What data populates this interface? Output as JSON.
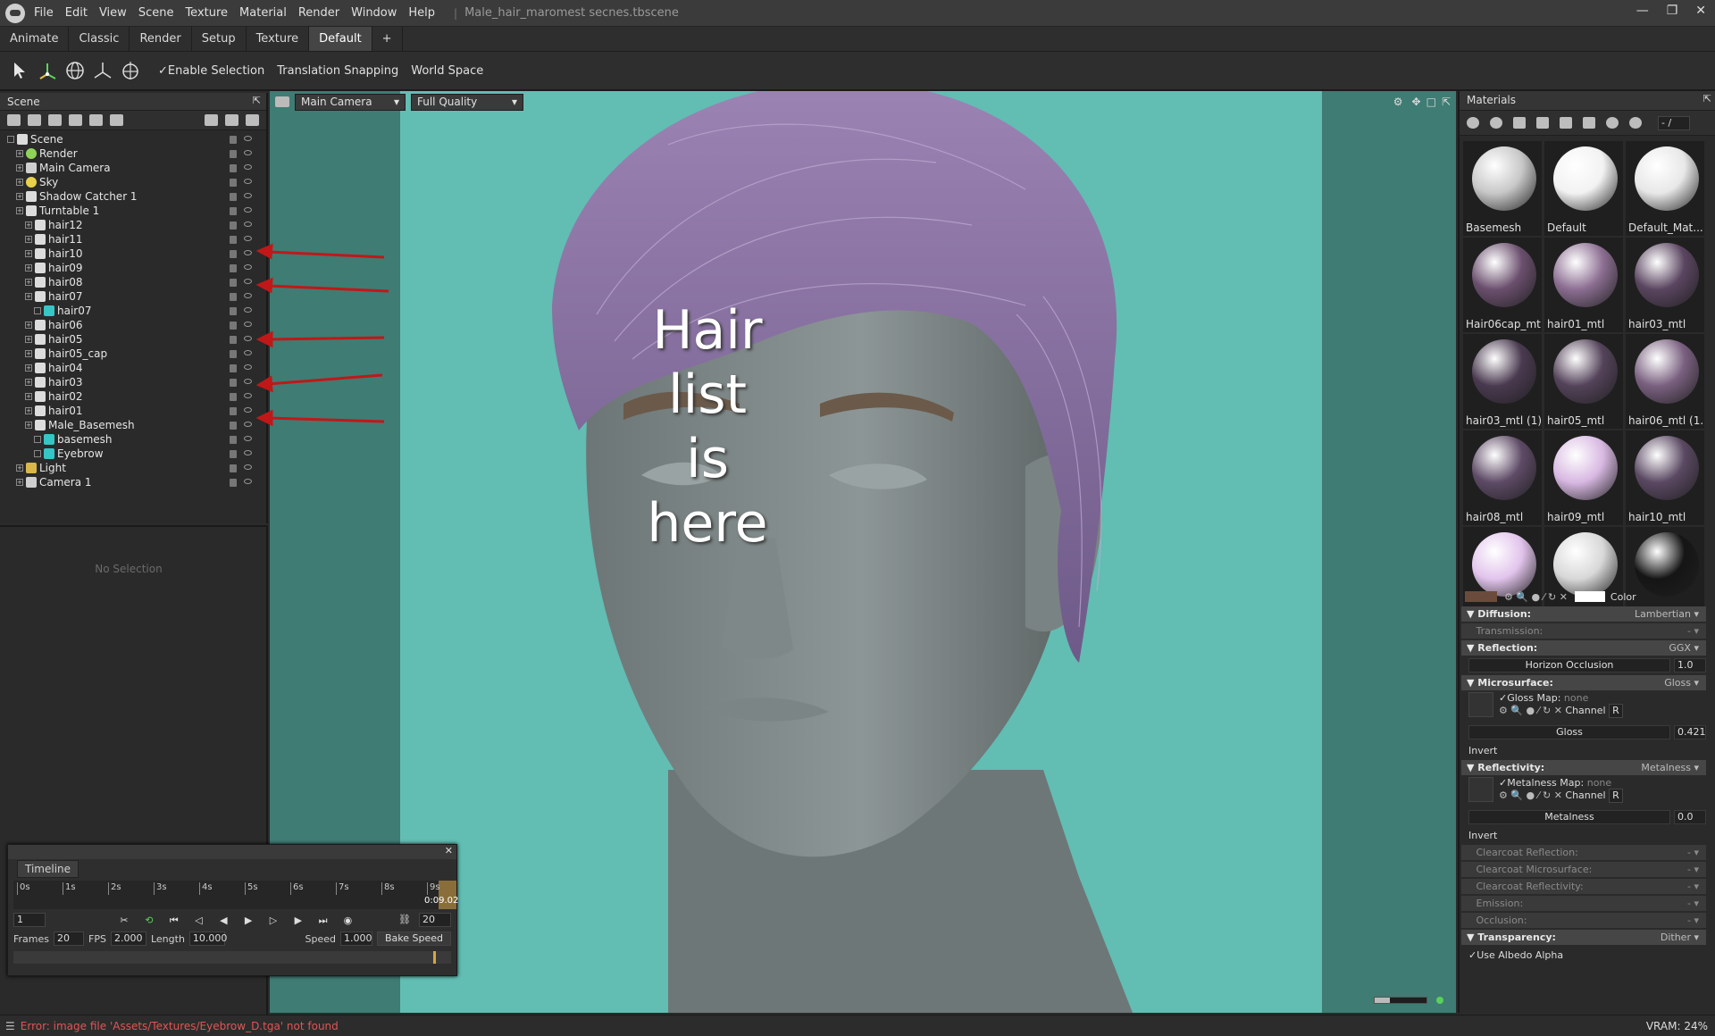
{
  "window": {
    "title": "Male_hair_maromest secnes.tbscene"
  },
  "menu": [
    "File",
    "Edit",
    "View",
    "Scene",
    "Texture",
    "Material",
    "Render",
    "Window",
    "Help"
  ],
  "tabs": [
    "Animate",
    "Classic",
    "Render",
    "Setup",
    "Texture",
    "Default",
    "+"
  ],
  "toolbar": {
    "enable_selection": "Enable Selection",
    "translation_snapping": "Translation Snapping",
    "world_space": "World Space"
  },
  "scene": {
    "title": "Scene",
    "items": [
      {
        "label": "Scene",
        "indent": 0,
        "icon": "scene-icon"
      },
      {
        "label": "Render",
        "indent": 1,
        "icon": "gear-icon"
      },
      {
        "label": "Main Camera",
        "indent": 1,
        "icon": "camera-icon"
      },
      {
        "label": "Sky",
        "indent": 1,
        "icon": "sun-icon"
      },
      {
        "label": "Shadow Catcher 1",
        "indent": 1,
        "icon": "shadow-icon"
      },
      {
        "label": "Turntable 1",
        "indent": 1,
        "icon": "turntable-icon"
      },
      {
        "label": "hair12",
        "indent": 2,
        "icon": "hair-icon"
      },
      {
        "label": "hair11",
        "indent": 2,
        "icon": "hair-icon"
      },
      {
        "label": "hair10",
        "indent": 2,
        "icon": "hair-icon"
      },
      {
        "label": "hair09",
        "indent": 2,
        "icon": "hair-icon"
      },
      {
        "label": "hair08",
        "indent": 2,
        "icon": "hair-icon"
      },
      {
        "label": "hair07",
        "indent": 2,
        "icon": "hair-icon"
      },
      {
        "label": "hair07",
        "indent": 3,
        "icon": "mesh-icon"
      },
      {
        "label": "hair06",
        "indent": 2,
        "icon": "hair-icon"
      },
      {
        "label": "hair05",
        "indent": 2,
        "icon": "hair-icon"
      },
      {
        "label": "hair05_cap",
        "indent": 2,
        "icon": "hair-icon"
      },
      {
        "label": "hair04",
        "indent": 2,
        "icon": "hair-icon"
      },
      {
        "label": "hair03",
        "indent": 2,
        "icon": "hair-icon"
      },
      {
        "label": "hair02",
        "indent": 2,
        "icon": "hair-icon"
      },
      {
        "label": "hair01",
        "indent": 2,
        "icon": "hair-icon"
      },
      {
        "label": "Male_Basemesh",
        "indent": 2,
        "icon": "hair-icon"
      },
      {
        "label": "basemesh",
        "indent": 3,
        "icon": "mesh-icon"
      },
      {
        "label": "Eyebrow",
        "indent": 3,
        "icon": "mesh-icon"
      },
      {
        "label": "Light",
        "indent": 1,
        "icon": "folder-icon"
      },
      {
        "label": "Camera 1",
        "indent": 1,
        "icon": "camera-icon"
      }
    ],
    "no_selection": "No Selection"
  },
  "viewport": {
    "camera": "Main Camera",
    "quality": "Full Quality"
  },
  "annotation": {
    "line1": "Hair",
    "line2": "list",
    "line3": "is",
    "line4": "here"
  },
  "materials": {
    "title": "Materials",
    "counter": "- /",
    "items": [
      {
        "label": "Basemesh",
        "color": "#c8c8c8"
      },
      {
        "label": "Default",
        "color": "#f2f2f2"
      },
      {
        "label": "Default_Mat...",
        "color": "#e8e8e8"
      },
      {
        "label": "Hair06cap_mtl",
        "color": "#6b4f6e"
      },
      {
        "label": "hair01_mtl",
        "color": "#8c6e92"
      },
      {
        "label": "hair03_mtl",
        "color": "#5a4560"
      },
      {
        "label": "hair03_mtl (1)",
        "color": "#4a3a50"
      },
      {
        "label": "hair05_mtl",
        "color": "#54435a"
      },
      {
        "label": "hair06_mtl (1...",
        "color": "#7a6080"
      },
      {
        "label": "hair08_mtl",
        "color": "#5e4a66"
      },
      {
        "label": "hair09_mtl",
        "color": "#d8b8e2"
      },
      {
        "label": "hair10_mtl",
        "color": "#5a4862"
      },
      {
        "label": "",
        "color": "#e2c4ec"
      },
      {
        "label": "",
        "color": "#d8d8d8"
      },
      {
        "label": "",
        "color": "#151515"
      }
    ],
    "color_label": "Color",
    "diffusion": {
      "label": "Diffusion:",
      "value": "Lambertian"
    },
    "transmission": {
      "label": "Transmission:",
      "value": "-"
    },
    "reflection": {
      "label": "Reflection:",
      "value": "GGX"
    },
    "horizon_occlusion": {
      "label": "Horizon Occlusion",
      "value": "1.0"
    },
    "microsurface": {
      "label": "Microsurface:",
      "value": "Gloss"
    },
    "gloss_map": {
      "label": "Gloss Map:",
      "value": "none",
      "channel_label": "Channel",
      "channel": "R"
    },
    "gloss": {
      "label": "Gloss",
      "value": "0.421"
    },
    "invert1": "Invert",
    "reflectivity": {
      "label": "Reflectivity:",
      "value": "Metalness"
    },
    "metalness_map": {
      "label": "Metalness Map:",
      "value": "none",
      "channel_label": "Channel",
      "channel": "R"
    },
    "metalness": {
      "label": "Metalness",
      "value": "0.0"
    },
    "invert2": "Invert",
    "clearcoat_reflection": {
      "label": "Clearcoat Reflection:",
      "value": "-"
    },
    "clearcoat_microsurface": {
      "label": "Clearcoat Microsurface:",
      "value": "-"
    },
    "clearcoat_reflectivity": {
      "label": "Clearcoat Reflectivity:",
      "value": "-"
    },
    "emission": {
      "label": "Emission:",
      "value": "-"
    },
    "occlusion": {
      "label": "Occlusion:",
      "value": "-"
    },
    "transparency": {
      "label": "Transparency:",
      "value": "Dither"
    },
    "use_albedo_alpha": "Use Albedo Alpha"
  },
  "timeline": {
    "title": "Timeline",
    "ticks": [
      "0s",
      "1s",
      "2s",
      "3s",
      "4s",
      "5s",
      "6s",
      "7s",
      "8s",
      "9s"
    ],
    "current_time": "0:09.02",
    "frame": "1",
    "end_frame": "20",
    "frames_label": "Frames",
    "frames": "20",
    "fps_label": "FPS",
    "fps": "2.000",
    "length_label": "Length",
    "length": "10.000",
    "speed_label": "Speed",
    "speed": "1.000",
    "bake_speed": "Bake Speed"
  },
  "status": {
    "error": "Error: image file 'Assets/Textures/Eyebrow_D.tga' not found",
    "vram": "VRAM: 24%"
  }
}
